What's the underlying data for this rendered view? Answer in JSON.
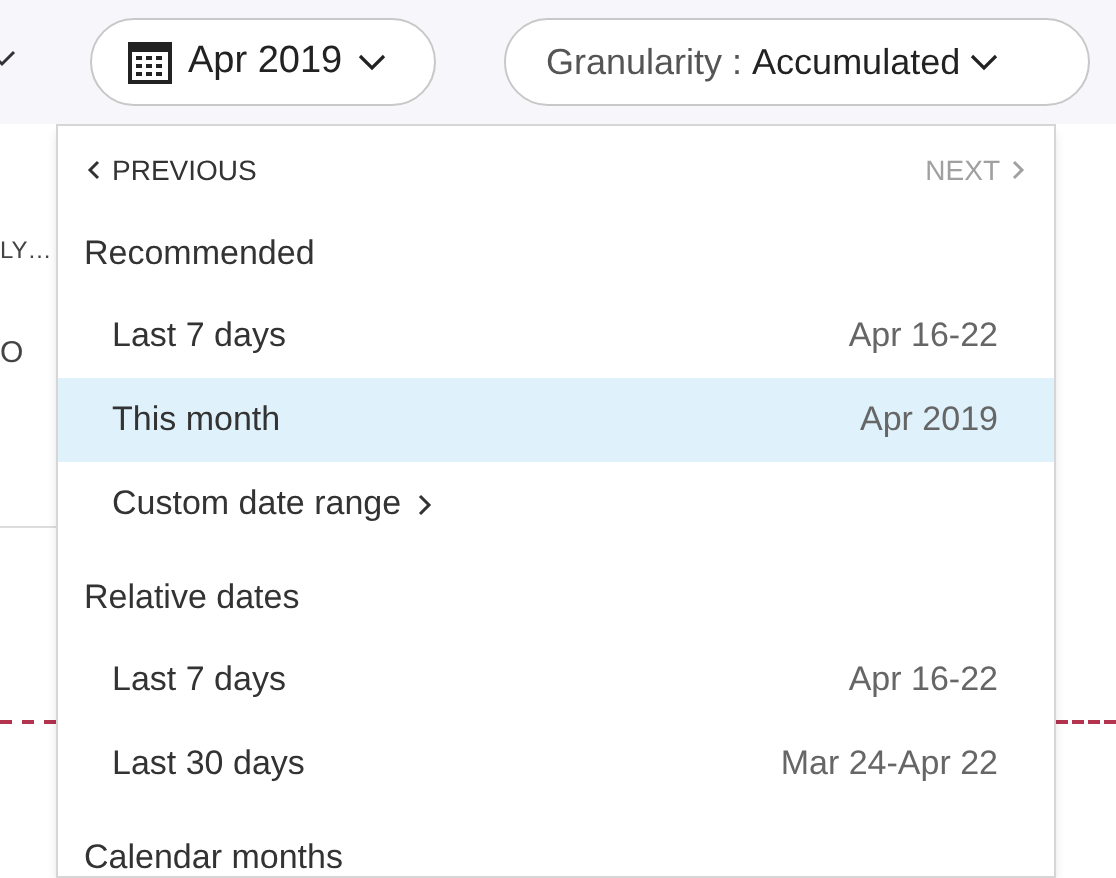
{
  "toolbar": {
    "date_picker": {
      "label": "Apr 2019"
    },
    "granularity": {
      "label": "Granularity",
      "separator": ":",
      "value": "Accumulated"
    }
  },
  "background": {
    "text_1": "LY…",
    "text_2": "O"
  },
  "dropdown": {
    "previous": {
      "label": "PREVIOUS",
      "disabled": false
    },
    "next": {
      "label": "NEXT",
      "disabled": true
    },
    "sections": [
      {
        "heading": "Recommended",
        "items": [
          {
            "kind": "range",
            "label": "Last 7 days",
            "range": "Apr 16-22",
            "selected": false
          },
          {
            "kind": "range",
            "label": "This month",
            "range": "Apr 2019",
            "selected": true
          },
          {
            "kind": "submenu",
            "label": "Custom date range",
            "selected": false
          }
        ]
      },
      {
        "heading": "Relative dates",
        "items": [
          {
            "kind": "range",
            "label": "Last 7 days",
            "range": "Apr 16-22",
            "selected": false
          },
          {
            "kind": "range",
            "label": "Last 30 days",
            "range": "Mar 24-Apr 22",
            "selected": false
          }
        ]
      },
      {
        "heading": "Calendar months"
      }
    ]
  }
}
